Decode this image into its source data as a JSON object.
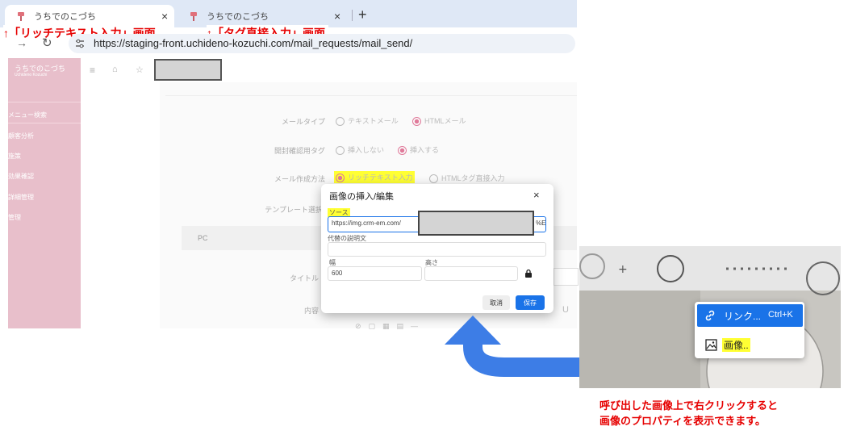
{
  "browser": {
    "tabs": [
      {
        "title": "うちでのこづち"
      },
      {
        "title": "うちでのこづち"
      }
    ],
    "close_glyph": "×",
    "new_tab_glyph": "+",
    "url": "https://staging-front.uchideno-kozuchi.com/mail_requests/mail_send/"
  },
  "annotations": {
    "rich_text_screen": "↑「リッチテキスト入力」画面",
    "tag_screen": "↑「タグ直接入力」画面",
    "note_line1": "呼び出した画像上で右クリックすると",
    "note_line2": "画像のプロパティを表示できます。"
  },
  "app": {
    "logo_name": "うちでのこづち",
    "logo_sub": "Uchideno Kozuchi",
    "sidebar_items": [
      "メニュー検索",
      "顧客分析",
      "施策",
      "効果確認",
      "詳細管理",
      "管理"
    ],
    "form": {
      "mail_type_label": "メールタイプ",
      "mail_type_options": [
        "テキストメール",
        "HTMLメール"
      ],
      "tag_label": "開封確認用タグ",
      "tag_options": [
        "挿入しない",
        "挿入する"
      ],
      "method_label": "メール作成方法",
      "method_options": [
        "リッチテキスト入力",
        "HTMLタグ直接入力"
      ],
      "template_label": "テンプレート選択",
      "tab_pc": "PC",
      "title_label": "タイトル",
      "body_label": "内容"
    }
  },
  "dialog": {
    "title": "画像の挿入/編集",
    "close_glyph": "×",
    "source_label": "ソース",
    "source_value": "https://img.crm-em.com/",
    "source_suffix": "%E",
    "alt_label": "代替の説明文",
    "width_label": "幅",
    "width_value": "600",
    "height_label": "高さ",
    "cancel_label": "取消",
    "save_label": "保存"
  },
  "context_menu": {
    "link_label": "リンク...",
    "link_shortcut": "Ctrl+K",
    "image_label": "画像.."
  },
  "colors": {
    "accent_blue": "#1a73e8",
    "highlight_yellow": "#ffff33",
    "annotation_red": "#e60000",
    "sidebar_pink": "#e8bfcb"
  }
}
